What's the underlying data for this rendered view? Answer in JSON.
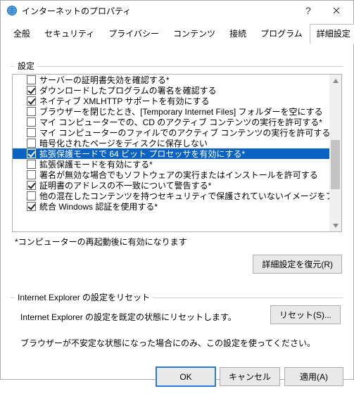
{
  "window": {
    "title": "インターネットのプロパティ"
  },
  "tabs": {
    "items": [
      {
        "label": "全般"
      },
      {
        "label": "セキュリティ"
      },
      {
        "label": "プライバシー"
      },
      {
        "label": "コンテンツ"
      },
      {
        "label": "接続"
      },
      {
        "label": "プログラム"
      },
      {
        "label": "詳細設定"
      }
    ],
    "active_index": 6
  },
  "settings_group": {
    "label": "設定",
    "items": [
      {
        "checked": false,
        "label": "サーバーの証明書失効を確認する*"
      },
      {
        "checked": true,
        "label": "ダウンロードしたプログラムの署名を確認する"
      },
      {
        "checked": true,
        "label": "ネイティブ XMLHTTP サポートを有効にする"
      },
      {
        "checked": false,
        "label": "ブラウザーを閉じたとき、[Temporary Internet Files] フォルダーを空にする"
      },
      {
        "checked": false,
        "label": "マイ コンピューターでの、CD のアクティブ コンテンツの実行を許可する*"
      },
      {
        "checked": false,
        "label": "マイ コンピューターのファイルでのアクティブ コンテンツの実行を許可する*"
      },
      {
        "checked": false,
        "label": "暗号化されたページをディスクに保存しない"
      },
      {
        "checked": true,
        "label": "拡張保護モードで 64 ビット プロセッサを有効にする*",
        "selected": true
      },
      {
        "checked": false,
        "label": "拡張保護モードを有効にする*"
      },
      {
        "checked": false,
        "label": "署名が無効な場合でもソフトウェアの実行またはインストールを許可する"
      },
      {
        "checked": true,
        "label": "証明書のアドレスの不一致について警告する*"
      },
      {
        "checked": false,
        "label": "他の混在したコンテンツを持つセキュリティで保護されていないイメージをブロックする"
      },
      {
        "checked": true,
        "label": "統合 Windows 認証を使用する*"
      }
    ],
    "note": "*コンピューターの再起動後に有効になります",
    "restore_button": "詳細設定を復元(R)"
  },
  "reset_group": {
    "label": "Internet Explorer の設定をリセット",
    "text": "Internet Explorer の設定を既定の状態にリセットします。",
    "button": "リセット(S)...",
    "description": "ブラウザーが不安定な状態になった場合にのみ、この設定を使ってください。"
  },
  "footer": {
    "ok": "OK",
    "cancel": "キャンセル",
    "apply": "適用(A)"
  }
}
